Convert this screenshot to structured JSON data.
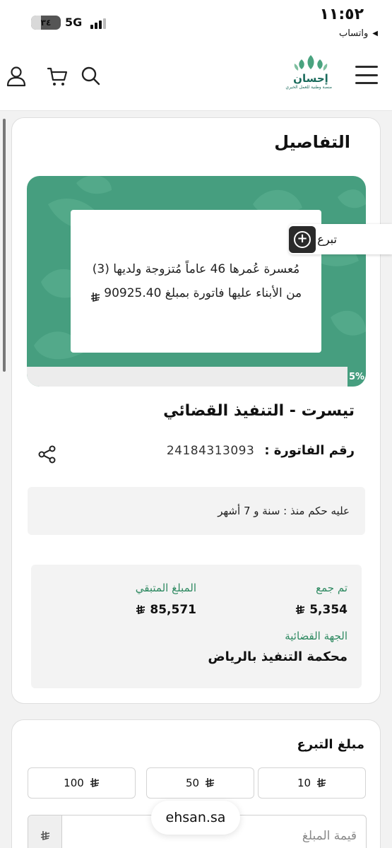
{
  "status_bar": {
    "time": "١١:٥٢",
    "back_app": "واتساب",
    "network": "5G",
    "battery": "٣٤",
    "battery_level": 0.34
  },
  "header": {
    "logo_title": "إحسان",
    "logo_subtitle": "منصة وطنية للعمل الخيري"
  },
  "details": {
    "title": "التفاصيل",
    "case_description": "مُعسرة عُمرها 46 عاماً مُتزوجة ولديها (3) من الأبناء عليها فاتورة بمبلغ 90925.40",
    "progress_label": "5%",
    "progress_fraction": 0.05,
    "quick_donate": "تبرع سريع",
    "case_title": "تيسرت - التنفيذ القضائي",
    "invoice_label": "رقم الفاتورة :",
    "invoice_number": "24184313093",
    "judgment_text": "عليه حكم منذ : سنة و 7 أشهر",
    "collected_label": "تم جمع",
    "collected_value": "5,354",
    "remaining_label": "المبلغ المتبقي",
    "remaining_value": "85,571",
    "court_label": "الجهة القضائية",
    "court_value": "محكمة التنفيذ بالرياض"
  },
  "donation": {
    "title": "مبلغ التبرع",
    "amounts": [
      "10",
      "50",
      "100"
    ],
    "custom_placeholder": "قيمة المبلغ",
    "custom_value": ""
  },
  "browser": {
    "url": "ehsan.sa"
  },
  "colors": {
    "brand_green": "#469e7f",
    "label_green": "#2f8a62",
    "logo_green": "#1a6b5c"
  },
  "icons": [
    "user-icon",
    "cart-icon",
    "search-icon",
    "menu-icon",
    "share-icon",
    "plus-circle-icon",
    "riyal-icon"
  ]
}
